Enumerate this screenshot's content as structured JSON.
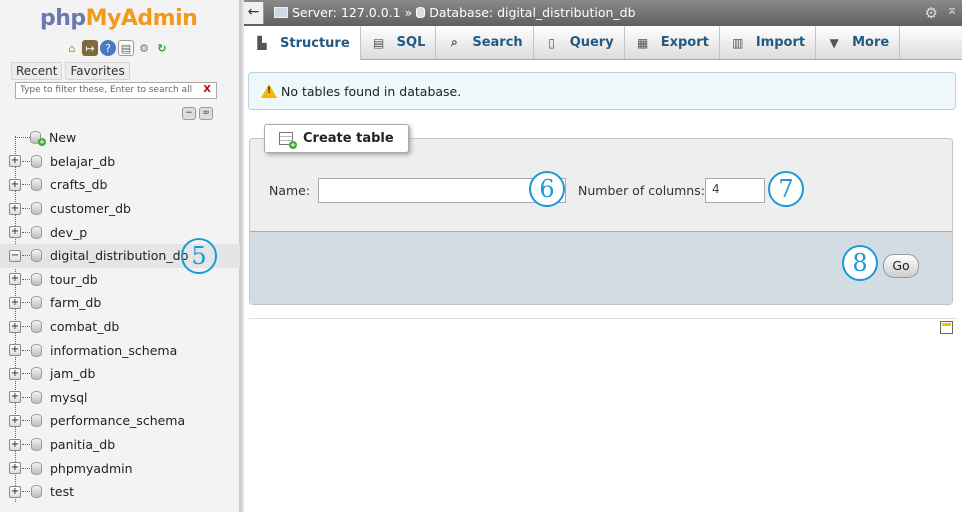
{
  "app": {
    "logo_php": "php",
    "logo_myadmin": "MyAdmin"
  },
  "sidebar": {
    "tabs": {
      "recent": "Recent",
      "favorites": "Favorites"
    },
    "filter_placeholder": "Type to filter these, Enter to search all",
    "filter_clear": "X",
    "new_label": "New",
    "databases": [
      {
        "name": "belajar_db",
        "expanded": false
      },
      {
        "name": "crafts_db",
        "expanded": false
      },
      {
        "name": "customer_db",
        "expanded": false
      },
      {
        "name": "dev_p",
        "expanded": false
      },
      {
        "name": "digital_distribution_db",
        "expanded": true,
        "active": true
      },
      {
        "name": "tour_db",
        "expanded": false
      },
      {
        "name": "farm_db",
        "expanded": false
      },
      {
        "name": "combat_db",
        "expanded": false
      },
      {
        "name": "information_schema",
        "expanded": false
      },
      {
        "name": "jam_db",
        "expanded": false
      },
      {
        "name": "mysql",
        "expanded": false
      },
      {
        "name": "performance_schema",
        "expanded": false
      },
      {
        "name": "panitia_db",
        "expanded": false
      },
      {
        "name": "phpmyadmin",
        "expanded": false
      },
      {
        "name": "test",
        "expanded": false
      }
    ]
  },
  "breadcrumb": {
    "server": "Server: 127.0.0.1",
    "separator": "»",
    "database": "Database: digital_distribution_db"
  },
  "tabs": [
    {
      "label": "Structure",
      "icon": "structure-icon",
      "active": true
    },
    {
      "label": "SQL",
      "icon": "sql-icon"
    },
    {
      "label": "Search",
      "icon": "search-icon"
    },
    {
      "label": "Query",
      "icon": "query-icon"
    },
    {
      "label": "Export",
      "icon": "export-icon"
    },
    {
      "label": "Import",
      "icon": "import-icon"
    },
    {
      "label": "More",
      "icon": "chevron-down-icon"
    }
  ],
  "notice": "No tables found in database.",
  "create_table": {
    "legend": "Create table",
    "name_label": "Name:",
    "name_value": "",
    "columns_label": "Number of columns:",
    "columns_value": "4",
    "go_label": "Go"
  },
  "annotations": {
    "step5": "5",
    "step6": "6",
    "step7": "7",
    "step8": "8"
  },
  "colors": {
    "accent": "#1b9ad6",
    "logo_php": "#6c78af",
    "logo_admin": "#f29a1c",
    "tab_text": "#235a81"
  }
}
